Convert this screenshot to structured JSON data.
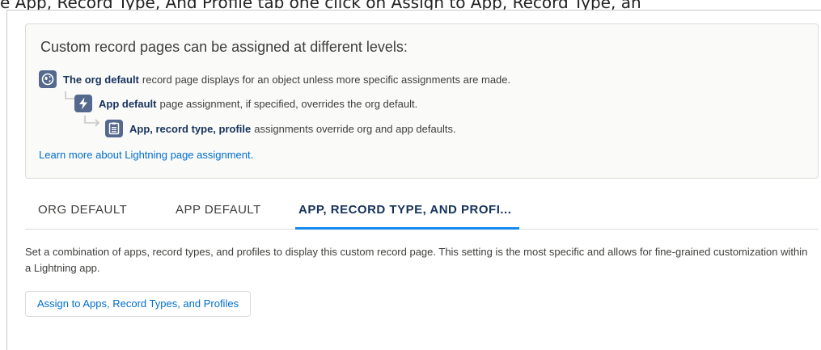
{
  "page_header_fragment": "e App, Record Type, And Profile tab one click on Assign to App, Record Type, an",
  "info": {
    "title": "Custom record pages can be assigned at different levels:",
    "levels": [
      {
        "icon": "globe-icon",
        "bold": "The org default",
        "text": "record page displays for an object unless more specific assignments are made."
      },
      {
        "icon": "lightning-icon",
        "bold": "App default",
        "text": "page assignment, if specified, overrides the org default."
      },
      {
        "icon": "record-page-icon",
        "bold": "App, record type, profile",
        "text": "assignments override org and app defaults."
      }
    ],
    "learn_more": "Learn more about Lightning page assignment."
  },
  "tabs": [
    {
      "label": "ORG DEFAULT",
      "active": false
    },
    {
      "label": "APP DEFAULT",
      "active": false
    },
    {
      "label": "APP, RECORD TYPE, AND PROFI...",
      "active": true
    }
  ],
  "description": "Set a combination of apps, record types, and profiles to display this custom record page. This setting is the most specific and allows for fine-grained customization within a Lightning app.",
  "assign_button": "Assign to Apps, Record Types, and Profiles",
  "colors": {
    "icon_bg": "#54698d",
    "link": "#006dcc",
    "active_tab_underline": "#1589ee",
    "heading_text": "#16325c"
  }
}
